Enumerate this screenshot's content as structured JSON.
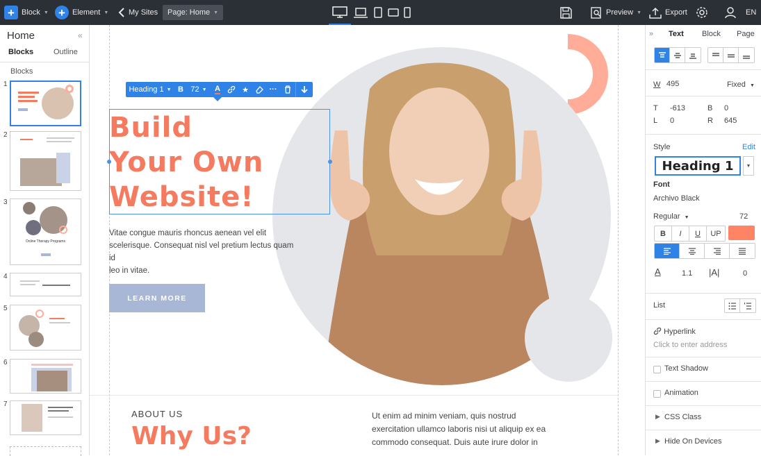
{
  "topbar": {
    "block_label": "Block",
    "element_label": "Element",
    "mysites_label": "My Sites",
    "page_label": "Page: Home",
    "preview_label": "Preview",
    "export_label": "Export",
    "lang_label": "EN"
  },
  "left_panel": {
    "title": "Home",
    "tab_blocks": "Blocks",
    "tab_outline": "Outline",
    "section_label": "Blocks",
    "thumbnails": [
      {
        "num": "1"
      },
      {
        "num": "2"
      },
      {
        "num": "3",
        "caption": "Online Therapy Programs"
      },
      {
        "num": "4"
      },
      {
        "num": "5"
      },
      {
        "num": "6"
      },
      {
        "num": "7"
      }
    ]
  },
  "canvas": {
    "toolbar": {
      "style_label": "Heading 1",
      "bold": "B",
      "size": "72"
    },
    "hero": {
      "heading_lines": [
        "Build",
        "Your Own",
        "Website!"
      ],
      "paragraph_lines": [
        "Vitae congue mauris rhoncus aenean vel elit",
        "scelerisque. Consequat nisl vel pretium lectus quam id",
        "leo in vitae."
      ],
      "button": "LEARN MORE"
    },
    "about": {
      "kicker": "ABOUT US",
      "title": "Why Us?",
      "para_lines": [
        "Ut enim ad minim veniam, quis nostrud",
        "exercitation ullamco laboris nisi ut aliquip ex ea",
        "commodo consequat. Duis aute irure dolor in"
      ]
    }
  },
  "right_panel": {
    "tabs": [
      "Text",
      "Block",
      "Page"
    ],
    "width_label": "W",
    "width_value": "495",
    "width_mode": "Fixed",
    "pos": {
      "t_label": "T",
      "t": "-613",
      "b_label": "B",
      "b": "0",
      "l_label": "L",
      "l": "0",
      "r_label": "R",
      "r": "645"
    },
    "style_label": "Style",
    "edit_label": "Edit",
    "style_value": "Heading 1",
    "font_label": "Font",
    "font_value": "Archivo Black",
    "weight": "Regular",
    "size": "72",
    "fmt": {
      "bold": "B",
      "italic": "I",
      "underline": "U",
      "upper": "UP"
    },
    "text_color": "#ff8465",
    "line_height": "1.1",
    "letter_spacing": "0",
    "list_label": "List",
    "hyperlink_label": "Hyperlink",
    "hyperlink_placeholder": "Click to enter address",
    "text_shadow_label": "Text Shadow",
    "animation_label": "Animation",
    "css_class_label": "CSS Class",
    "hide_label": "Hide On Devices"
  },
  "colors": {
    "accent": "#2f83e6",
    "coral": "#f47b5f",
    "button": "#a9b7d6"
  }
}
